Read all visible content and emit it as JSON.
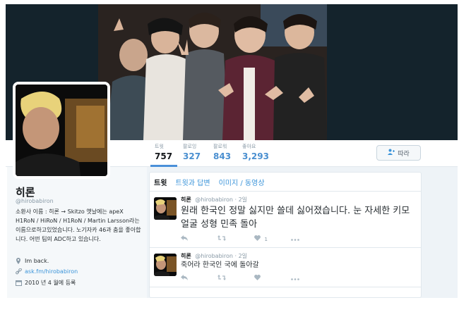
{
  "profile": {
    "name": "히론",
    "handle": "@hirobabiron",
    "bio": "소환사 이름 : 히론 → Skitzo 옛날에는 apeX H1RoN / HiRoN / H1RoN / Martin Larsson라는 이름으로하고있었습니다. 노기자카 46과 춤을 좋아합니다. 어떤 팀의 ADC하고 있습니다.",
    "location": "Im back.",
    "website": "ask.fm/hirobabiron",
    "joined": "2010 년 4 월에 등록"
  },
  "stats": [
    {
      "label": "트윗",
      "value": "757"
    },
    {
      "label": "팔로잉",
      "value": "327"
    },
    {
      "label": "팔로워",
      "value": "843"
    },
    {
      "label": "좋아요",
      "value": "3,293"
    }
  ],
  "follow_button": {
    "label": "따라"
  },
  "tabs": [
    {
      "label": "트윗"
    },
    {
      "label": "트윗과 답변"
    },
    {
      "label": "이미지 / 동영상"
    }
  ],
  "tweets": [
    {
      "name": "히론",
      "handle": "@hirobabiron",
      "time": "· 2일",
      "text": "원래 한국인 정말 싫지만 쓸데 싫어졌습니다. 눈 자세한 키모 얼굴 성형 민족 돌아",
      "likes": "1"
    },
    {
      "name": "히론",
      "handle": "@hirobabiron",
      "time": "· 2일",
      "text": "죽어라 한국인 국에 돌아갈",
      "likes": ""
    }
  ],
  "colors": {
    "accent": "#3b94d9",
    "header": "#14232c",
    "profile_bg": "#f5f8fa"
  }
}
